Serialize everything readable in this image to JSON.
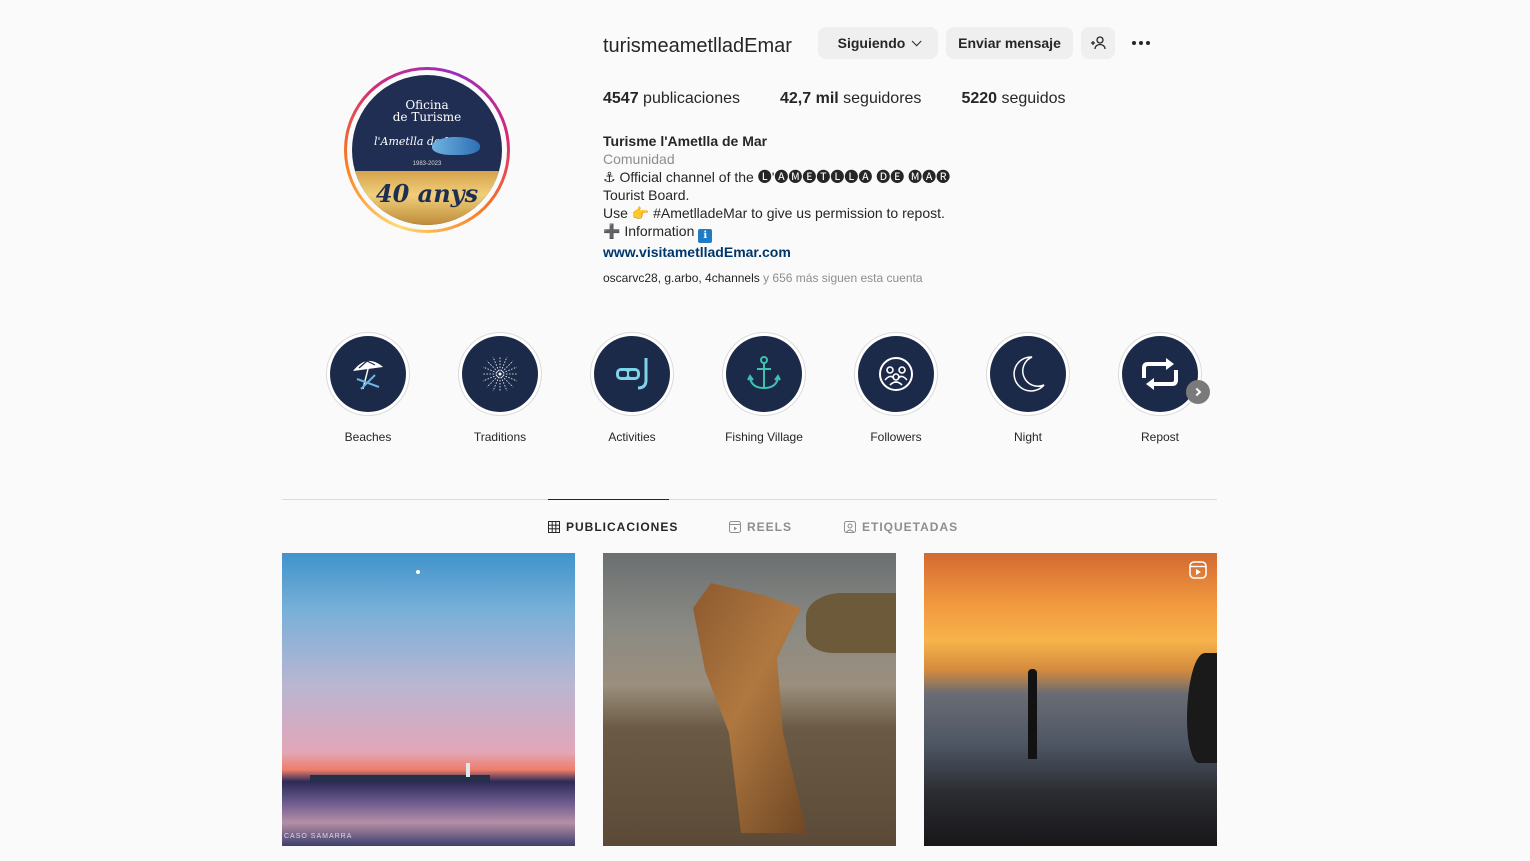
{
  "profile": {
    "username": "turismeametlladEmar",
    "avatar": {
      "line1": "Oficina",
      "line2": "de Turisme",
      "brand": "l'Ametlla de Mar",
      "years": "1983-2023",
      "anniversary": "40 anys"
    },
    "buttons": {
      "following": "Siguiendo",
      "message": "Enviar mensaje"
    },
    "stats": {
      "posts_count": "4547",
      "posts_label": "publicaciones",
      "followers_count": "42,7 mil",
      "followers_label": "seguidores",
      "following_count": "5220",
      "following_label": "seguidos"
    },
    "bio": {
      "name": "Turisme l'Ametlla de Mar",
      "category": "Comunidad",
      "line1": "⚓ Official channel of the 🅛'🅐🅜🅔🅣🅛🅛🅐 🅓🅔 🅜🅐🅡",
      "line2": "Tourist Board.",
      "line3": "Use 👉 #AmetlladeMar to give us permission to repost.",
      "line4_text": "➕ Information",
      "line4_icon": "ℹ",
      "link": "www.visitametlladEmar.com"
    },
    "followed_by": {
      "users": "oscarvc28, g.arbo, 4channels",
      "rest": " y 656 más siguen esta cuenta"
    }
  },
  "highlights": [
    {
      "label": "Beaches",
      "icon": "umbrella-chair-icon"
    },
    {
      "label": "Traditions",
      "icon": "fireworks-icon"
    },
    {
      "label": "Activities",
      "icon": "snorkel-mask-icon"
    },
    {
      "label": "Fishing Village",
      "icon": "anchor-icon"
    },
    {
      "label": "Followers",
      "icon": "people-icon"
    },
    {
      "label": "Night",
      "icon": "moon-icon"
    },
    {
      "label": "Repost",
      "icon": "repost-icon"
    }
  ],
  "tabs": [
    {
      "label": "PUBLICACIONES",
      "icon": "grid-icon",
      "active": true
    },
    {
      "label": "REELS",
      "icon": "reels-icon",
      "active": false
    },
    {
      "label": "ETIQUETADAS",
      "icon": "tagged-icon",
      "active": false
    }
  ],
  "posts": [
    {
      "type": "image",
      "credit": "CASO SAMARRA"
    },
    {
      "type": "image"
    },
    {
      "type": "reel",
      "icon": "reel-badge-icon"
    }
  ],
  "colors": {
    "highlight_bg": "#1c2a4a",
    "link": "#00376b",
    "button_bg": "#efefef"
  }
}
